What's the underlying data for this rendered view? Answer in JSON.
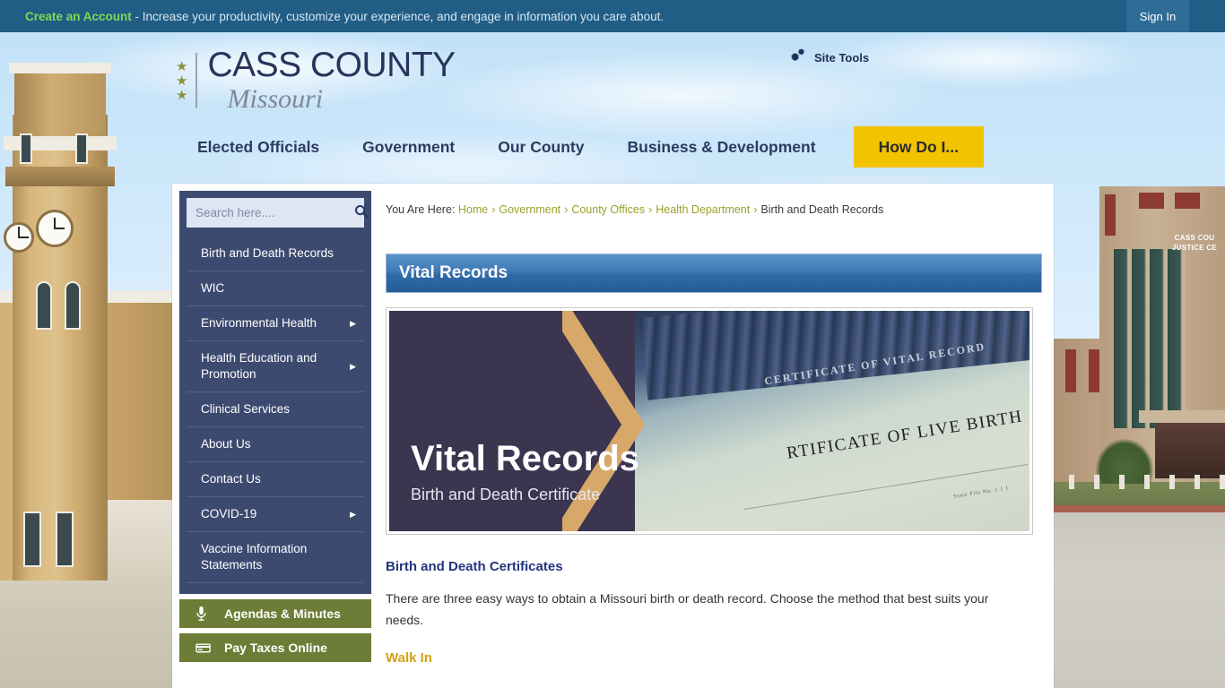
{
  "topbar": {
    "cta_label": "Create an Account",
    "message": " - Increase your productivity, customize your experience, and engage in information you care about.",
    "signin_label": "Sign In"
  },
  "header": {
    "logo_title": "CASS COUNTY",
    "logo_subtitle": "Missouri",
    "site_tools_label": "Site Tools"
  },
  "mainnav": {
    "items": [
      {
        "label": "Elected Officials"
      },
      {
        "label": "Government"
      },
      {
        "label": "Our County"
      },
      {
        "label": "Business & Development"
      }
    ],
    "cta_label": "How Do I..."
  },
  "sidebar": {
    "search_placeholder": "Search here....",
    "search_value": "",
    "items": [
      {
        "label": "Birth and Death Records",
        "has_arrow": false
      },
      {
        "label": "WIC",
        "has_arrow": false
      },
      {
        "label": "Environmental Health",
        "has_arrow": true
      },
      {
        "label": "Health Education and Promotion",
        "has_arrow": true
      },
      {
        "label": "Clinical Services",
        "has_arrow": false
      },
      {
        "label": "About Us",
        "has_arrow": false
      },
      {
        "label": "Contact Us",
        "has_arrow": false
      },
      {
        "label": "COVID-19",
        "has_arrow": true
      },
      {
        "label": "Vaccine Information Statements",
        "has_arrow": false
      }
    ],
    "buttons": [
      {
        "label": "Agendas & Minutes",
        "icon": "microphone-icon"
      },
      {
        "label": "Pay Taxes Online",
        "icon": "credit-card-icon"
      }
    ]
  },
  "breadcrumb": {
    "prefix": "You Are Here:",
    "links": [
      "Home",
      "Government",
      "County Offices",
      "Health Department"
    ],
    "separator": "›",
    "current": "Birth and Death Records"
  },
  "main": {
    "section_title": "Vital Records",
    "hero": {
      "title": "Vital Records",
      "subtitle": "Birth and Death Certificate",
      "photo_text_top": "CERTIFICATE OF VITAL RECORD",
      "photo_text_main": "RTIFICATE OF LIVE BIRTH",
      "photo_text_file": "State File No.   1 1 1"
    },
    "heading": "Birth and Death Certificates",
    "paragraph": "There are three easy ways to obtain a Missouri birth or death record. Choose the method that best suits your needs.",
    "subheading": "Walk In"
  },
  "background": {
    "right_building_sign_line1": "CASS COU",
    "right_building_sign_line2": "JUSTICE CE"
  }
}
